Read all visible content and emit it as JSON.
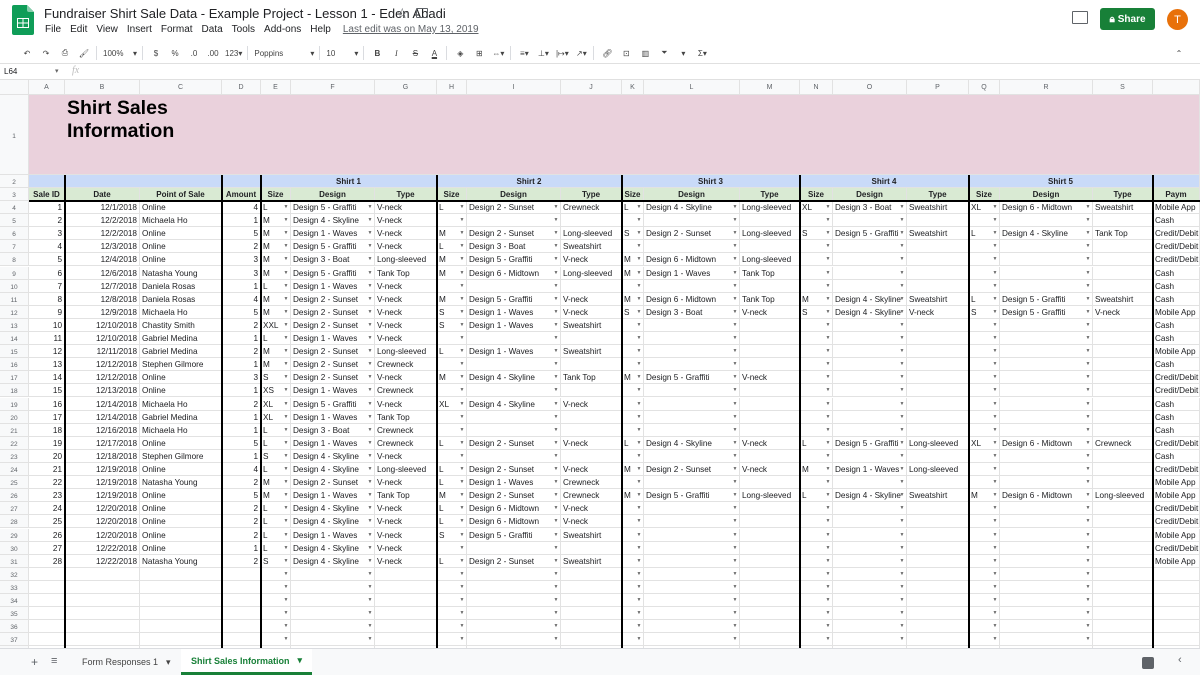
{
  "app": {
    "title": "Fundraiser Shirt Sale Data - Example Project - Lesson 1 - Eden Abadi",
    "last_edit": "Last edit was on May 13, 2019",
    "share_label": "Share",
    "avatar_letter": "T"
  },
  "menu": [
    "File",
    "Edit",
    "View",
    "Insert",
    "Format",
    "Data",
    "Tools",
    "Add-ons",
    "Help"
  ],
  "toolbar": {
    "zoom": "100%",
    "currency": "$",
    "percent": "%",
    "dec_less": ".0",
    "dec_more": ".00",
    "format_more": "123",
    "font": "Poppins",
    "font_size": "10",
    "bold": "B",
    "italic": "I",
    "strike": "S",
    "text_color": "A"
  },
  "formula_bar": {
    "cell_ref": "L64",
    "fx": "fx"
  },
  "grid": {
    "columns": [
      "A",
      "B",
      "C",
      "D",
      "E",
      "F",
      "G",
      "H",
      "I",
      "J",
      "K",
      "L",
      "M",
      "N",
      "O",
      "P",
      "Q",
      "R",
      "S",
      ""
    ],
    "title_line1": "Shirt Sales",
    "title_line2": "Information",
    "shirt_groups": [
      "Shirt 1",
      "Shirt 2",
      "Shirt 3",
      "Shirt 4",
      "Shirt 5"
    ],
    "headers": [
      "Sale ID",
      "Date",
      "Point of Sale",
      "Amount",
      "Size",
      "Design",
      "Type",
      "Size",
      "Design",
      "Type",
      "Size",
      "Design",
      "Type",
      "Size",
      "Design",
      "Type",
      "Size",
      "Design",
      "Type",
      "Paym"
    ],
    "rows": [
      [
        "1",
        "12/1/2018",
        "Online",
        "4",
        "L",
        "Design 5 - Graffiti",
        "V-neck",
        "L",
        "Design 2 - Sunset",
        "Crewneck",
        "L",
        "Design 4 - Skyline",
        "Long-sleeved",
        "XL",
        "Design 3 - Boat",
        "Sweatshirt",
        "XL",
        "Design 6 - Midtown",
        "Sweatshirt",
        "Mobile App"
      ],
      [
        "2",
        "12/2/2018",
        "Michaela Ho",
        "1",
        "M",
        "Design 4 - Skyline",
        "V-neck",
        "",
        "",
        "",
        "",
        "",
        "",
        "",
        "",
        "",
        "",
        "",
        "",
        "Cash"
      ],
      [
        "3",
        "12/2/2018",
        "Online",
        "5",
        "M",
        "Design 1 - Waves",
        "V-neck",
        "M",
        "Design 2 - Sunset",
        "Long-sleeved",
        "S",
        "Design 2 - Sunset",
        "Long-sleeved",
        "S",
        "Design 5 - Graffiti",
        "Sweatshirt",
        "L",
        "Design 4 - Skyline",
        "Tank Top",
        "Credit/Debit"
      ],
      [
        "4",
        "12/3/2018",
        "Online",
        "2",
        "M",
        "Design 5 - Graffiti",
        "V-neck",
        "L",
        "Design 3 - Boat",
        "Sweatshirt",
        "",
        "",
        "",
        "",
        "",
        "",
        "",
        "",
        "",
        "Credit/Debit"
      ],
      [
        "5",
        "12/4/2018",
        "Online",
        "3",
        "M",
        "Design 3 - Boat",
        "Long-sleeved",
        "M",
        "Design 5 - Graffiti",
        "V-neck",
        "M",
        "Design 6 - Midtown",
        "Long-sleeved",
        "",
        "",
        "",
        "",
        "",
        "",
        "Credit/Debit"
      ],
      [
        "6",
        "12/6/2018",
        "Natasha Young",
        "3",
        "M",
        "Design 5 - Graffiti",
        "Tank Top",
        "M",
        "Design 6 - Midtown",
        "Long-sleeved",
        "M",
        "Design 1 - Waves",
        "Tank Top",
        "",
        "",
        "",
        "",
        "",
        "",
        "Cash"
      ],
      [
        "7",
        "12/7/2018",
        "Daniela Rosas",
        "1",
        "L",
        "Design 1 - Waves",
        "V-neck",
        "",
        "",
        "",
        "",
        "",
        "",
        "",
        "",
        "",
        "",
        "",
        "",
        "Cash"
      ],
      [
        "8",
        "12/8/2018",
        "Daniela Rosas",
        "4",
        "M",
        "Design 2 - Sunset",
        "V-neck",
        "M",
        "Design 5 - Graffiti",
        "V-neck",
        "M",
        "Design 6 - Midtown",
        "Tank Top",
        "M",
        "Design 4 - Skyline",
        "Sweatshirt",
        "L",
        "Design 5 - Graffiti",
        "Sweatshirt",
        "Cash"
      ],
      [
        "9",
        "12/9/2018",
        "Michaela Ho",
        "5",
        "M",
        "Design 2 - Sunset",
        "V-neck",
        "S",
        "Design 1 - Waves",
        "V-neck",
        "S",
        "Design 3 - Boat",
        "V-neck",
        "S",
        "Design 4 - Skyline",
        "V-neck",
        "S",
        "Design 5 - Graffiti",
        "V-neck",
        "Mobile App"
      ],
      [
        "10",
        "12/10/2018",
        "Chastity Smith",
        "2",
        "XXL",
        "Design 2 - Sunset",
        "V-neck",
        "S",
        "Design 1 - Waves",
        "Sweatshirt",
        "",
        "",
        "",
        "",
        "",
        "",
        "",
        "",
        "",
        "Cash"
      ],
      [
        "11",
        "12/10/2018",
        "Gabriel Medina",
        "1",
        "L",
        "Design 1 - Waves",
        "V-neck",
        "",
        "",
        "",
        "",
        "",
        "",
        "",
        "",
        "",
        "",
        "",
        "",
        "Cash"
      ],
      [
        "12",
        "12/11/2018",
        "Gabriel Medina",
        "2",
        "M",
        "Design 2 - Sunset",
        "Long-sleeved",
        "L",
        "Design 1 - Waves",
        "Sweatshirt",
        "",
        "",
        "",
        "",
        "",
        "",
        "",
        "",
        "",
        "Mobile App"
      ],
      [
        "13",
        "12/12/2018",
        "Stephen Gilmore",
        "1",
        "M",
        "Design 2 - Sunset",
        "Crewneck",
        "",
        "",
        "",
        "",
        "",
        "",
        "",
        "",
        "",
        "",
        "",
        "",
        "Cash"
      ],
      [
        "14",
        "12/12/2018",
        "Online",
        "3",
        "S",
        "Design 2 - Sunset",
        "V-neck",
        "M",
        "Design 4 - Skyline",
        "Tank Top",
        "M",
        "Design 5 - Graffiti",
        "V-neck",
        "",
        "",
        "",
        "",
        "",
        "",
        "Credit/Debit"
      ],
      [
        "15",
        "12/13/2018",
        "Online",
        "1",
        "XS",
        "Design 1 - Waves",
        "Crewneck",
        "",
        "",
        "",
        "",
        "",
        "",
        "",
        "",
        "",
        "",
        "",
        "",
        "Credit/Debit"
      ],
      [
        "16",
        "12/14/2018",
        "Michaela Ho",
        "2",
        "XL",
        "Design 5 - Graffiti",
        "V-neck",
        "XL",
        "Design 4 - Skyline",
        "V-neck",
        "",
        "",
        "",
        "",
        "",
        "",
        "",
        "",
        "",
        "Cash"
      ],
      [
        "17",
        "12/14/2018",
        "Gabriel Medina",
        "1",
        "XL",
        "Design 1 - Waves",
        "Tank Top",
        "",
        "",
        "",
        "",
        "",
        "",
        "",
        "",
        "",
        "",
        "",
        "",
        "Cash"
      ],
      [
        "18",
        "12/16/2018",
        "Michaela Ho",
        "1",
        "L",
        "Design 3 - Boat",
        "Crewneck",
        "",
        "",
        "",
        "",
        "",
        "",
        "",
        "",
        "",
        "",
        "",
        "",
        "Cash"
      ],
      [
        "19",
        "12/17/2018",
        "Online",
        "5",
        "L",
        "Design 1 - Waves",
        "Crewneck",
        "L",
        "Design 2 - Sunset",
        "V-neck",
        "L",
        "Design 4 - Skyline",
        "V-neck",
        "L",
        "Design 5 - Graffiti",
        "Long-sleeved",
        "XL",
        "Design 6 - Midtown",
        "Crewneck",
        "Credit/Debit"
      ],
      [
        "20",
        "12/18/2018",
        "Stephen Gilmore",
        "1",
        "S",
        "Design 4 - Skyline",
        "V-neck",
        "",
        "",
        "",
        "",
        "",
        "",
        "",
        "",
        "",
        "",
        "",
        "",
        "Cash"
      ],
      [
        "21",
        "12/19/2018",
        "Online",
        "4",
        "L",
        "Design 4 - Skyline",
        "Long-sleeved",
        "L",
        "Design 2 - Sunset",
        "V-neck",
        "M",
        "Design 2 - Sunset",
        "V-neck",
        "M",
        "Design 1 - Waves",
        "Long-sleeved",
        "",
        "",
        "",
        "Credit/Debit"
      ],
      [
        "22",
        "12/19/2018",
        "Natasha Young",
        "2",
        "M",
        "Design 2 - Sunset",
        "V-neck",
        "L",
        "Design 1 - Waves",
        "Crewneck",
        "",
        "",
        "",
        "",
        "",
        "",
        "",
        "",
        "",
        "Mobile App"
      ],
      [
        "23",
        "12/19/2018",
        "Online",
        "5",
        "M",
        "Design 1 - Waves",
        "Tank Top",
        "M",
        "Design 2 - Sunset",
        "Crewneck",
        "M",
        "Design 5 - Graffiti",
        "Long-sleeved",
        "L",
        "Design 4 - Skyline",
        "Sweatshirt",
        "M",
        "Design 6 - Midtown",
        "Long-sleeved",
        "Mobile App"
      ],
      [
        "24",
        "12/20/2018",
        "Online",
        "2",
        "L",
        "Design 4 - Skyline",
        "V-neck",
        "L",
        "Design 6 - Midtown",
        "V-neck",
        "",
        "",
        "",
        "",
        "",
        "",
        "",
        "",
        "",
        "Credit/Debit"
      ],
      [
        "25",
        "12/20/2018",
        "Online",
        "2",
        "L",
        "Design 4 - Skyline",
        "V-neck",
        "L",
        "Design 6 - Midtown",
        "V-neck",
        "",
        "",
        "",
        "",
        "",
        "",
        "",
        "",
        "",
        "Credit/Debit"
      ],
      [
        "26",
        "12/20/2018",
        "Online",
        "2",
        "L",
        "Design 1 - Waves",
        "V-neck",
        "S",
        "Design 5 - Graffiti",
        "Sweatshirt",
        "",
        "",
        "",
        "",
        "",
        "",
        "",
        "",
        "",
        "Mobile App"
      ],
      [
        "27",
        "12/22/2018",
        "Online",
        "1",
        "L",
        "Design 4 - Skyline",
        "V-neck",
        "",
        "",
        "",
        "",
        "",
        "",
        "",
        "",
        "",
        "",
        "",
        "",
        "Credit/Debit"
      ],
      [
        "28",
        "12/22/2018",
        "Natasha Young",
        "2",
        "S",
        "Design 4 - Skyline",
        "V-neck",
        "L",
        "Design 2 - Sunset",
        "Sweatshirt",
        "",
        "",
        "",
        "",
        "",
        "",
        "",
        "",
        "",
        "Mobile App"
      ]
    ]
  },
  "sheets": {
    "tab1": "Form Responses 1",
    "tab2": "Shirt Sales Information"
  }
}
